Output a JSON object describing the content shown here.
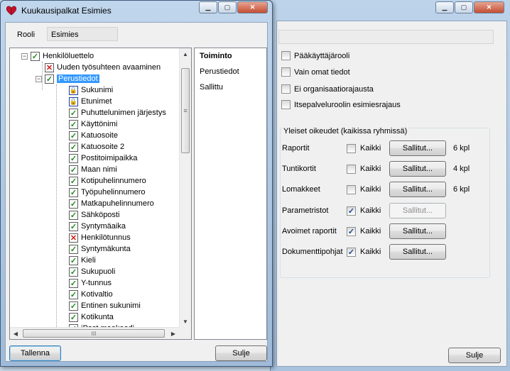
{
  "background_window": {
    "role_checkboxes": [
      {
        "label": "Pääkäyttäjärooli",
        "checked": false
      },
      {
        "label": "Vain omat tiedot",
        "checked": false
      },
      {
        "label": "Ei organisaatiorajausta",
        "checked": false
      },
      {
        "label": "Itsepalveluroolin esimiesrajaus",
        "checked": false
      }
    ],
    "rights_group_title": "Yleiset oikeudet (kaikissa ryhmissä)",
    "rights": [
      {
        "label": "Raportit",
        "all_label": "Kaikki",
        "all_checked": false,
        "button": "Sallitut...",
        "enabled": true,
        "count": "6 kpl"
      },
      {
        "label": "Tuntikortit",
        "all_label": "Kaikki",
        "all_checked": false,
        "button": "Sallitut...",
        "enabled": true,
        "count": "4 kpl"
      },
      {
        "label": "Lomakkeet",
        "all_label": "Kaikki",
        "all_checked": false,
        "button": "Sallitut...",
        "enabled": true,
        "count": "6 kpl"
      },
      {
        "label": "Parametristot",
        "all_label": "Kaikki",
        "all_checked": true,
        "button": "Sallitut...",
        "enabled": false,
        "count": ""
      },
      {
        "label": "Avoimet raportit",
        "all_label": "Kaikki",
        "all_checked": true,
        "button": "Sallitut...",
        "enabled": true,
        "count": ""
      },
      {
        "label": "Dokumenttipohjat",
        "all_label": "Kaikki",
        "all_checked": true,
        "button": "Sallitut...",
        "enabled": true,
        "count": ""
      }
    ],
    "close_button": "Sulje"
  },
  "dialog": {
    "title": "Kuukausipalkat Esimies",
    "role_label": "Rooli",
    "role_value": "Esimies",
    "tree": [
      {
        "label": "Henkilöluettelo",
        "icon": "check",
        "level": 0,
        "expander": "−",
        "selected": false
      },
      {
        "label": "Uuden työsuhteen avaaminen",
        "icon": "cross",
        "level": 1,
        "expander": "",
        "selected": false
      },
      {
        "label": "Perustiedot",
        "icon": "check",
        "level": 1,
        "expander": "−",
        "selected": true
      },
      {
        "label": "Sukunimi",
        "icon": "lock",
        "level": 2,
        "expander": "",
        "selected": false
      },
      {
        "label": "Etunimet",
        "icon": "lock",
        "level": 2,
        "expander": "",
        "selected": false
      },
      {
        "label": "Puhuttelunimen järjestys",
        "icon": "check",
        "level": 2,
        "expander": "",
        "selected": false
      },
      {
        "label": "Käyttönimi",
        "icon": "check",
        "level": 2,
        "expander": "",
        "selected": false
      },
      {
        "label": "Katuosoite",
        "icon": "check",
        "level": 2,
        "expander": "",
        "selected": false
      },
      {
        "label": "Katuosoite 2",
        "icon": "check",
        "level": 2,
        "expander": "",
        "selected": false
      },
      {
        "label": "Postitoimipaikka",
        "icon": "check",
        "level": 2,
        "expander": "",
        "selected": false
      },
      {
        "label": "Maan nimi",
        "icon": "check",
        "level": 2,
        "expander": "",
        "selected": false
      },
      {
        "label": "Kotipuhelinnumero",
        "icon": "check",
        "level": 2,
        "expander": "",
        "selected": false
      },
      {
        "label": "Työpuhelinnumero",
        "icon": "check",
        "level": 2,
        "expander": "",
        "selected": false
      },
      {
        "label": "Matkapuhelinnumero",
        "icon": "check",
        "level": 2,
        "expander": "",
        "selected": false
      },
      {
        "label": "Sähköposti",
        "icon": "check",
        "level": 2,
        "expander": "",
        "selected": false
      },
      {
        "label": "Syntymäaika",
        "icon": "check",
        "level": 2,
        "expander": "",
        "selected": false
      },
      {
        "label": "Henkilötunnus",
        "icon": "cross",
        "level": 2,
        "expander": "",
        "selected": false
      },
      {
        "label": "Syntymäkunta",
        "icon": "check",
        "level": 2,
        "expander": "",
        "selected": false
      },
      {
        "label": "Kieli",
        "icon": "check",
        "level": 2,
        "expander": "",
        "selected": false
      },
      {
        "label": "Sukupuoli",
        "icon": "check",
        "level": 2,
        "expander": "",
        "selected": false
      },
      {
        "label": "Y-tunnus",
        "icon": "check",
        "level": 2,
        "expander": "",
        "selected": false
      },
      {
        "label": "Kotivaltio",
        "icon": "check",
        "level": 2,
        "expander": "",
        "selected": false
      },
      {
        "label": "Entinen sukunimi",
        "icon": "check",
        "level": 2,
        "expander": "",
        "selected": false
      },
      {
        "label": "Kotikunta",
        "icon": "check",
        "level": 2,
        "expander": "",
        "selected": false
      },
      {
        "label": "iPost maakoodi",
        "icon": "check",
        "level": 2,
        "expander": "",
        "selected": false
      }
    ],
    "action_list": {
      "header": "Toiminto",
      "items": [
        "Perustiedot",
        "Sallittu"
      ]
    },
    "save_button": "Tallenna",
    "close_button": "Sulje"
  },
  "icons": {
    "expander_minus": "−",
    "check": "✓",
    "cross": "✕",
    "lock": "🔒",
    "scroll_up": "▲",
    "scroll_down": "▼",
    "scroll_left": "◀",
    "scroll_right": "▶",
    "grip_v": "≡",
    "grip_h": "III"
  }
}
